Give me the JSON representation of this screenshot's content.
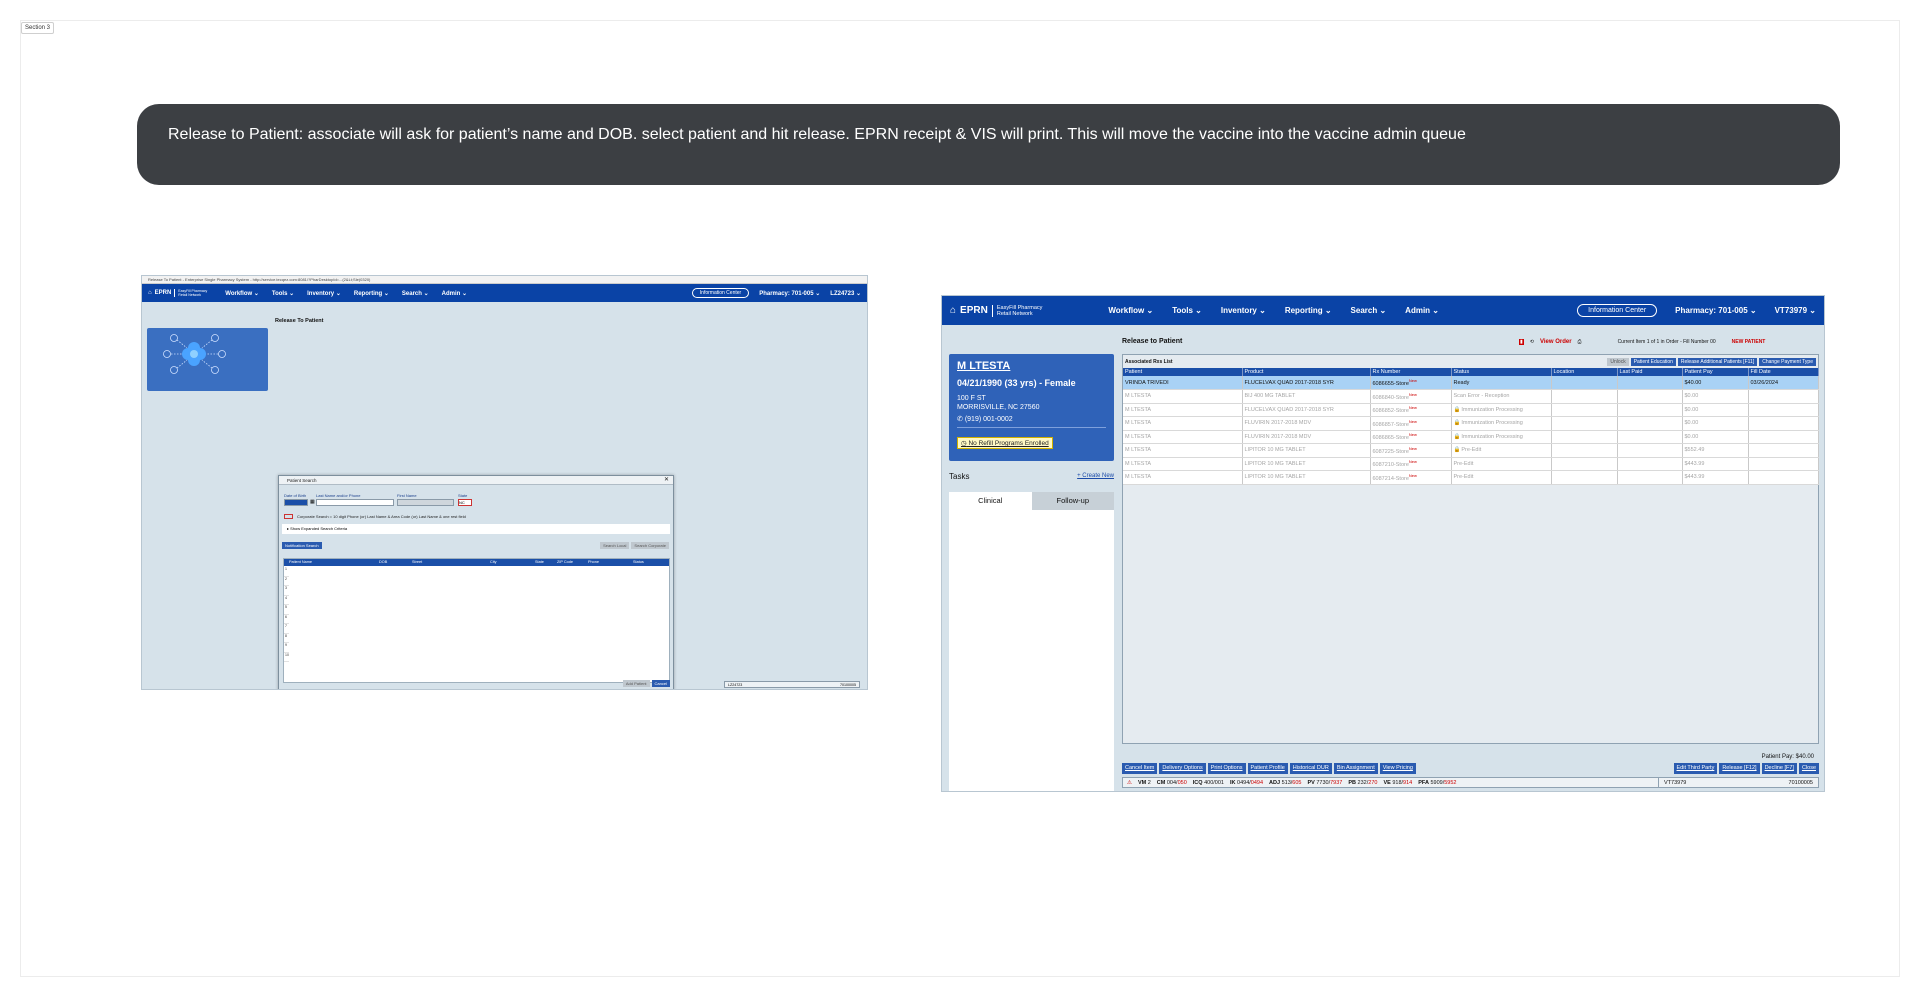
{
  "section_tag": "Section 3",
  "banner_text": "Release to Patient: associate will ask for patient’s name and DOB. select patient and hit release. EPRN receipt & VIS will print. This will move the vaccine into the vaccine admin queue",
  "left_screen": {
    "window_title": "Release To Patient - Enterprise Single Pharmacy System - http://service.tecqez.com:8081/?PharDesktopId=...(2&Lt;Sle)0320)",
    "logo": "EPRN",
    "logo_sub_1": "EasyFill Pharmacy",
    "logo_sub_2": "Retail Network",
    "menu": [
      "Workflow",
      "Tools",
      "Inventory",
      "Reporting",
      "Search",
      "Admin"
    ],
    "info_center": "Information Center",
    "pharmacy": "Pharmacy: 701-005",
    "user": "LZ24723",
    "page_title": "Release To Patient",
    "dialog": {
      "title": "Patient Search",
      "close": "✕",
      "labels": {
        "dob": "Date of Birth",
        "last": "Last Name and/or Phone",
        "first": "First Name",
        "state": "State"
      },
      "dob_value": "",
      "state_value": "NC",
      "hint": "Corporate Search = 10 digit Phone (or) Last Name & Area Code (or) Last Name & one rest field",
      "expand": "Show Expanded Search Criteria",
      "notif_search": "Notification Search",
      "search_local": "Search Local",
      "search_corporate": "Search Corporate",
      "columns": [
        "Patient Name",
        "DOB",
        "Street",
        "City",
        "State",
        "ZIP Code",
        "Phone",
        "Status"
      ],
      "row_numbers": [
        "1",
        "2",
        "3",
        "4",
        "5",
        "6",
        "7",
        "8",
        "9",
        "10"
      ],
      "add_patient": "Add Patient",
      "cancel": "Cancel"
    },
    "status_user": "LZ24723",
    "status_code": "70100005"
  },
  "right_screen": {
    "logo": "EPRN",
    "logo_sub_1": "EasyFill Pharmacy",
    "logo_sub_2": "Retail Network",
    "menu": [
      "Workflow",
      "Tools",
      "Inventory",
      "Reporting",
      "Search",
      "Admin"
    ],
    "info_center": "Information Center",
    "pharmacy": "Pharmacy: 701-005",
    "user": "VT73979",
    "patient": {
      "name": "M LTESTA",
      "dob_line": "04/21/1990 (33 yrs) - Female",
      "addr1": "100 F ST",
      "addr2": "MORRISVILLE, NC 27560",
      "phone": "(919) 001-0002",
      "refill": "No Refill Programs Enrolled"
    },
    "tasks_label": "Tasks",
    "create_new": "+ Create New",
    "tab_clinical": "Clinical",
    "tab_followup": "Follow-up",
    "main_title": "Release to Patient",
    "view_order": "View Order",
    "current_item": "Current Item 1 of 1 in Order - Fill Number 00",
    "new_patient": "NEW PATIENT",
    "grid_title": "Associated Rxs List",
    "grid_buttons": [
      "Unlock",
      "Patient Education",
      "Release Additional Patients [F11]",
      "Change Payment Type"
    ],
    "columns": [
      "Patient",
      "Product",
      "Rx Number",
      "Status",
      "Location",
      "Last Paid",
      "Patient Pay",
      "Fill Date"
    ],
    "rows": [
      {
        "patient": "VRINDA TRIVEDI",
        "product": "FLUCELVAX QUAD 2017-2018 SYR",
        "rx": "6086655-Store",
        "status": "Ready",
        "location": "",
        "last_paid": "",
        "pay": "$40.00",
        "fill": "03/26/2024"
      },
      {
        "patient": "M LTESTA",
        "product": "BIJ 400 MG TABLET",
        "rx": "6086840-Store",
        "status": "Scan Error - Reception",
        "location": "",
        "last_paid": "",
        "pay": "$0.00",
        "fill": ""
      },
      {
        "patient": "M LTESTA",
        "product": "FLUCELVAX QUAD 2017-2018 SYR",
        "rx": "6086852-Store",
        "status": "Immunization Processing",
        "location": "",
        "last_paid": "",
        "pay": "$0.00",
        "fill": ""
      },
      {
        "patient": "M LTESTA",
        "product": "FLUVIRIN 2017-2018 MDV",
        "rx": "6086857-Store",
        "status": "Immunization Processing",
        "location": "",
        "last_paid": "",
        "pay": "$0.00",
        "fill": ""
      },
      {
        "patient": "M LTESTA",
        "product": "FLUVIRIN 2017-2018 MDV",
        "rx": "6086865-Store",
        "status": "Immunization Processing",
        "location": "",
        "last_paid": "",
        "pay": "$0.00",
        "fill": ""
      },
      {
        "patient": "M LTESTA",
        "product": "LIPITOR 10 MG TABLET",
        "rx": "6087225-Store",
        "status": "Pre-Edit",
        "location": "",
        "last_paid": "",
        "pay": "$552.49",
        "fill": ""
      },
      {
        "patient": "M LTESTA",
        "product": "LIPITOR 10 MG TABLET",
        "rx": "6087210-Store",
        "status": "Pre-Edit",
        "location": "",
        "last_paid": "",
        "pay": "$443.99",
        "fill": ""
      },
      {
        "patient": "M LTESTA",
        "product": "LIPITOR 10 MG TABLET",
        "rx": "6087214-Store",
        "status": "Pre-Edit",
        "location": "",
        "last_paid": "",
        "pay": "$443.99",
        "fill": ""
      }
    ],
    "rx_new_badge": "New",
    "patient_pay_total": "Patient Pay: $40.00",
    "actions_left": [
      "Cancel Item",
      "Delivery Options",
      "Print Options",
      "Patient Profile",
      "Historical DUR",
      "Bin Assignment",
      "View Pricing"
    ],
    "actions_right": [
      "Edit Third Party",
      "Release [F12]",
      "Decline [F7]",
      "Close"
    ],
    "status_items": [
      {
        "label": "VM",
        "value": "2"
      },
      {
        "label": "CM",
        "value": "004/",
        "red": "050"
      },
      {
        "label": "ICQ",
        "value": "400/001",
        "red": ""
      },
      {
        "label": "IK",
        "value": "0494/",
        "red": "0494"
      },
      {
        "label": "ADJ",
        "value": "513/",
        "red": "605"
      },
      {
        "label": "PV",
        "value": "7730/",
        "red": "7937"
      },
      {
        "label": "PB",
        "value": "232/",
        "red": "270"
      },
      {
        "label": "VE",
        "value": "918/",
        "red": "914"
      },
      {
        "label": "PFA",
        "value": "5909/",
        "red": "5952"
      }
    ],
    "status_user": "VT73979",
    "status_code": "70100005",
    "colors": {
      "nav": "#0a43a6",
      "accent_blue": "#2a5bb0",
      "selected_row": "#a9d2f5",
      "alert_red": "#cc0000"
    }
  }
}
